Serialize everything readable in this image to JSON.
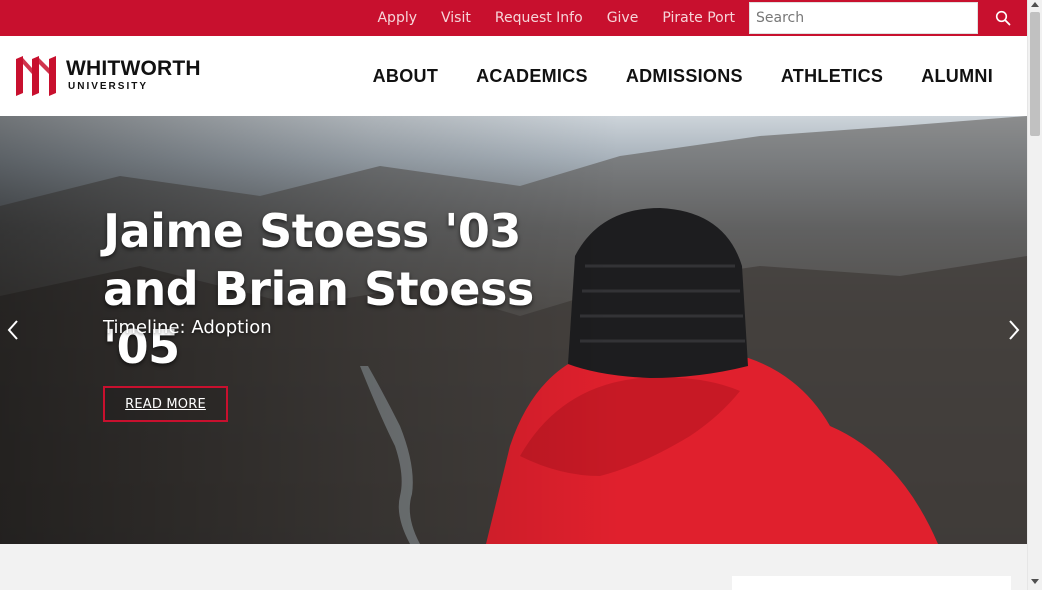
{
  "utility_nav": {
    "links": [
      "Apply",
      "Visit",
      "Request Info",
      "Give",
      "Pirate Port"
    ],
    "search_placeholder": "Search",
    "search_icon": "search-icon"
  },
  "brand": {
    "name": "WHITWORTH",
    "sub": "UNIVERSITY",
    "logo_icon": "whitworth-w-logo-icon"
  },
  "main_nav": {
    "items": [
      "ABOUT",
      "ACADEMICS",
      "ADMISSIONS",
      "ATHLETICS",
      "ALUMNI"
    ]
  },
  "hero": {
    "title": "Jaime Stoess '03 and Brian Stoess '05",
    "subtitle": "Timeline: Adoption",
    "button_label": "READ MORE",
    "prev_icon": "chevron-left-icon",
    "next_icon": "chevron-right-icon"
  },
  "colors": {
    "brand_red": "#c8102e",
    "utility_text": "#f6d5d9",
    "nav_text": "#111111",
    "page_bg": "#f2f2f2"
  }
}
